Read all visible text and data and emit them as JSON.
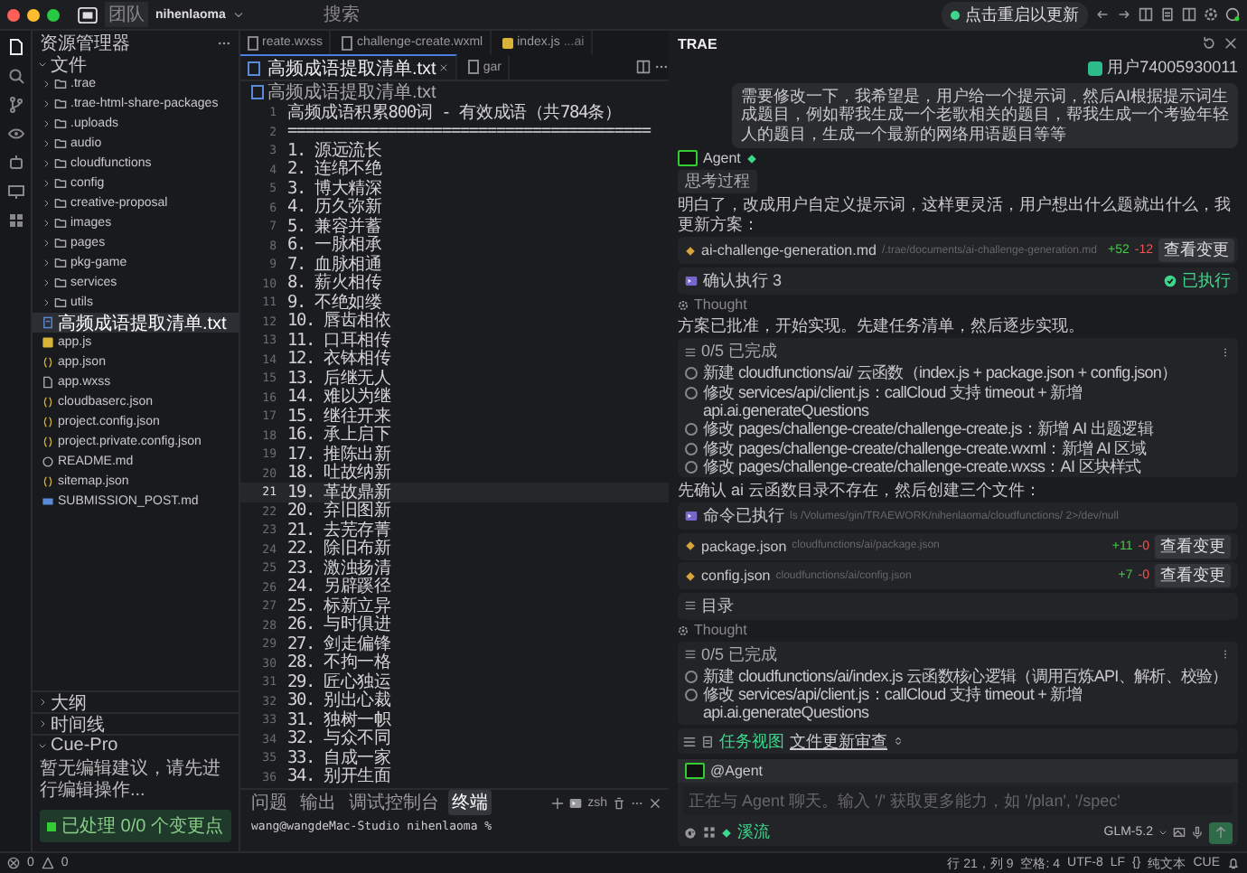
{
  "titlebar": {
    "badge": "团队",
    "project": "nihenlaoma",
    "search": "搜索",
    "update_button": "点击重启以更新"
  },
  "activity_bar": [
    {
      "kind": "files",
      "selected": true
    },
    {
      "kind": "search",
      "selected": false
    },
    {
      "kind": "branch",
      "selected": false
    },
    {
      "kind": "eye",
      "selected": false
    },
    {
      "kind": "robot",
      "selected": false
    },
    {
      "kind": "monitor",
      "selected": false
    },
    {
      "kind": "grid",
      "selected": false
    }
  ],
  "sidebar": {
    "title": "资源管理器",
    "root": {
      "label": "文件",
      "expanded": true,
      "children": [
        {
          "label": ".trae",
          "kind": "folder",
          "selected": false
        },
        {
          "label": ".trae-html-share-packages",
          "kind": "folder",
          "selected": false
        },
        {
          "label": ".uploads",
          "kind": "folder",
          "selected": false
        },
        {
          "label": "audio",
          "kind": "folder",
          "selected": false
        },
        {
          "label": "cloudfunctions",
          "kind": "folder",
          "selected": false
        },
        {
          "label": "config",
          "kind": "folder",
          "selected": false
        },
        {
          "label": "creative-proposal",
          "kind": "folder",
          "selected": false
        },
        {
          "label": "images",
          "kind": "folder",
          "selected": false
        },
        {
          "label": "pages",
          "kind": "folder",
          "selected": false
        },
        {
          "label": "pkg-game",
          "kind": "folder",
          "selected": false
        },
        {
          "label": "services",
          "kind": "folder",
          "selected": false
        },
        {
          "label": "utils",
          "kind": "folder",
          "selected": false
        },
        {
          "label": "高频成语提取清单.txt",
          "kind": "text",
          "selected": true
        },
        {
          "label": "app.js",
          "kind": "js",
          "selected": false
        },
        {
          "label": "app.json",
          "kind": "json",
          "selected": false
        },
        {
          "label": "app.wxss",
          "kind": "file",
          "selected": false
        },
        {
          "label": "cloudbaserc.json",
          "kind": "json",
          "selected": false
        },
        {
          "label": "project.config.json",
          "kind": "json",
          "selected": false
        },
        {
          "label": "project.private.config.json",
          "kind": "json",
          "selected": false
        },
        {
          "label": "README.md",
          "kind": "info",
          "selected": false
        },
        {
          "label": "sitemap.json",
          "kind": "json",
          "selected": false
        },
        {
          "label": "SUBMISSION_POST.md",
          "kind": "markdown",
          "selected": false
        }
      ]
    },
    "sections": [
      {
        "label": "大纲",
        "expanded": false
      },
      {
        "label": "时间线",
        "expanded": false
      },
      {
        "label": "Cue-Pro",
        "expanded": true
      }
    ],
    "cue_message": "暂无编辑建议，请先进行编辑操作...",
    "cue_status": "已处理 0/0 个变更点"
  },
  "editor": {
    "tabs": [
      {
        "label": "reate.wxss",
        "kind": "file",
        "selected": false
      },
      {
        "label": "challenge-create.wxml",
        "kind": "file",
        "selected": false
      },
      {
        "label": "index.js",
        "hint": "...ai",
        "kind": "js",
        "selected": false
      },
      {
        "label": "高频成语提取清单.txt",
        "kind": "text",
        "selected": true
      },
      {
        "label": "gar",
        "kind": "file",
        "selected": false
      }
    ],
    "breadcrumb": "高频成语提取清单.txt",
    "lines": [
      {
        "number": "1",
        "text": "高频成语积累800词 - 有效成语（共784条）",
        "selected": false
      },
      {
        "number": "2",
        "text": "========================================",
        "selected": false
      },
      {
        "number": "3",
        "text": "1. 源远流长",
        "selected": false
      },
      {
        "number": "4",
        "text": "2. 连绵不绝",
        "selected": false
      },
      {
        "number": "5",
        "text": "3. 博大精深",
        "selected": false
      },
      {
        "number": "6",
        "text": "4. 历久弥新",
        "selected": false
      },
      {
        "number": "7",
        "text": "5. 兼容并蓄",
        "selected": false
      },
      {
        "number": "8",
        "text": "6. 一脉相承",
        "selected": false
      },
      {
        "number": "9",
        "text": "7. 血脉相通",
        "selected": false
      },
      {
        "number": "10",
        "text": "8. 薪火相传",
        "selected": false
      },
      {
        "number": "11",
        "text": "9. 不绝如缕",
        "selected": false
      },
      {
        "number": "12",
        "text": "10. 唇齿相依",
        "selected": false
      },
      {
        "number": "13",
        "text": "11. 口耳相传",
        "selected": false
      },
      {
        "number": "14",
        "text": "12. 衣钵相传",
        "selected": false
      },
      {
        "number": "15",
        "text": "13. 后继无人",
        "selected": false
      },
      {
        "number": "16",
        "text": "14. 难以为继",
        "selected": false
      },
      {
        "number": "17",
        "text": "15. 继往开来",
        "selected": false
      },
      {
        "number": "18",
        "text": "16. 承上启下",
        "selected": false
      },
      {
        "number": "19",
        "text": "17. 推陈出新",
        "selected": false
      },
      {
        "number": "20",
        "text": "18. 吐故纳新",
        "selected": false
      },
      {
        "number": "21",
        "text": "19. 革故鼎新",
        "selected": true
      },
      {
        "number": "22",
        "text": "20. 弃旧图新",
        "selected": false
      },
      {
        "number": "23",
        "text": "21. 去芜存菁",
        "selected": false
      },
      {
        "number": "24",
        "text": "22. 除旧布新",
        "selected": false
      },
      {
        "number": "25",
        "text": "23. 激浊扬清",
        "selected": false
      },
      {
        "number": "26",
        "text": "24. 另辟蹊径",
        "selected": false
      },
      {
        "number": "27",
        "text": "25. 标新立异",
        "selected": false
      },
      {
        "number": "28",
        "text": "26. 与时俱进",
        "selected": false
      },
      {
        "number": "29",
        "text": "27. 剑走偏锋",
        "selected": false
      },
      {
        "number": "30",
        "text": "28. 不拘一格",
        "selected": false
      },
      {
        "number": "31",
        "text": "29. 匠心独运",
        "selected": false
      },
      {
        "number": "32",
        "text": "30. 别出心裁",
        "selected": false
      },
      {
        "number": "33",
        "text": "31. 独树一帜",
        "selected": false
      },
      {
        "number": "34",
        "text": "32. 与众不同",
        "selected": false
      },
      {
        "number": "35",
        "text": "33. 自成一家",
        "selected": false
      },
      {
        "number": "36",
        "text": "34. 别开生面",
        "selected": false
      }
    ]
  },
  "panel": {
    "tabs": [
      {
        "label": "问题",
        "selected": false
      },
      {
        "label": "输出",
        "selected": false
      },
      {
        "label": "调试控制台",
        "selected": false
      },
      {
        "label": "终端",
        "selected": true
      }
    ],
    "shell": "zsh",
    "prompt": "wang@wangdeMac-Studio nihenlaoma %"
  },
  "chat": {
    "title": "TRAE",
    "user": "用户74005930011",
    "user_message": "需要修改一下，我希望是，用户给一个提示词，然后AI根据提示词生成题目，例如帮我生成一个老歌相关的题目，帮我生成一个考验年轻人的题目，生成一个最新的网络用语题目等等",
    "agent": "Agent",
    "blocks": [
      {
        "kind": "chip",
        "text": "思考过程"
      },
      {
        "kind": "text",
        "text": "明白了，改成用户自定义提示词，这样更灵活，用户想出什么题就出什么，我更新方案："
      },
      {
        "kind": "file",
        "name": "ai-challenge-generation.md",
        "path": "/.trae/documents/ai-challenge-generation.md",
        "added": "+52",
        "removed": "-12",
        "action": "查看变更"
      },
      {
        "kind": "run",
        "text": "确认执行 3",
        "status": "已执行"
      },
      {
        "kind": "thought",
        "text": "Thought"
      },
      {
        "kind": "text",
        "text": "方案已批准，开始实现。先建任务清单，然后逐步实现。"
      },
      {
        "kind": "todo",
        "title": "0/5 已完成",
        "items": [
          "新建 cloudfunctions/ai/ 云函数（index.js + package.json + config.json）",
          "修改 services/api/client.js：callCloud 支持 timeout + 新增 api.ai.generateQuestions",
          "修改 pages/challenge-create/challenge-create.js：新增 AI 出题逻辑",
          "修改 pages/challenge-create/challenge-create.wxml：新增 AI 区域",
          "修改 pages/challenge-create/challenge-create.wxss：AI 区块样式"
        ]
      },
      {
        "kind": "text",
        "text": "先确认 ai 云函数目录不存在，然后创建三个文件："
      },
      {
        "kind": "command",
        "text": "命令已执行",
        "path": "ls /Volumes/gin/TRAEWORK/nihenlaoma/cloudfunctions/ 2>/dev/null"
      },
      {
        "kind": "file",
        "name": "package.json",
        "path": "cloudfunctions/ai/package.json",
        "added": "+11",
        "removed": "-0",
        "action": "查看变更"
      },
      {
        "kind": "file",
        "name": "config.json",
        "path": "cloudfunctions/ai/config.json",
        "added": "+7",
        "removed": "-0",
        "action": "查看变更"
      },
      {
        "kind": "list",
        "text": "目录"
      },
      {
        "kind": "thought",
        "text": "Thought"
      },
      {
        "kind": "todo",
        "title": "0/5 已完成",
        "items": [
          "新建 cloudfunctions/ai/index.js 云函数核心逻辑（调用百炼API、解析、校验）",
          "修改 services/api/client.js：callCloud 支持 timeout + 新增 api.ai.generateQuestions"
        ]
      }
    ],
    "view_toggle": "任务视图",
    "review_link": "文件更新审查",
    "mention": "@Agent",
    "input_placeholder": "正在与 Agent 聊天。输入 '/' 获取更多能力，如 '/plan', '/spec'",
    "mode": "溪流",
    "model": "GLM-5.2"
  },
  "status_bar": {
    "errors": "0",
    "warnings": "0",
    "items": [
      "行 21，列 9",
      "空格: 4",
      "UTF-8",
      "LF",
      "{}",
      "纯文本",
      "CUE"
    ]
  }
}
